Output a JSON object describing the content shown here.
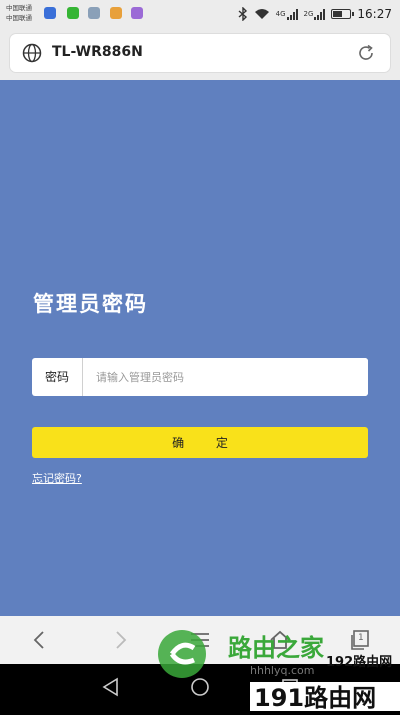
{
  "status_bar": {
    "carrier_1": "中国联通",
    "carrier_2": "中国联通",
    "net_1": "4G",
    "net_2": "2G",
    "time": "16:27",
    "battery_level": 0.6,
    "icons": [
      "message-icon",
      "wechat-icon",
      "gallery-icon",
      "gallery-icon",
      "app-icon",
      "bluetooth-icon",
      "wifi-icon",
      "signal-icon",
      "battery-icon"
    ]
  },
  "browser": {
    "url": "TL-WR886N"
  },
  "login": {
    "title": "管理员密码",
    "password_label": "密码",
    "password_placeholder": "请输入管理员密码",
    "password_value": "",
    "confirm_label": "确 定",
    "forgot_label": "忘记密码?"
  },
  "browser_nav": {
    "icons": [
      "back-icon",
      "forward-icon",
      "menu-icon",
      "home-icon",
      "tabs-icon"
    ],
    "tabs_count": "1"
  },
  "watermark": {
    "brand": "路由之家",
    "site": "hhhlyq.com",
    "brand_2": "192路由网",
    "brand_3": "191路由网"
  },
  "colors": {
    "page_bg": "#6080bf",
    "confirm_bg": "#f9e11a",
    "watermark_green": "#3aa83a"
  }
}
